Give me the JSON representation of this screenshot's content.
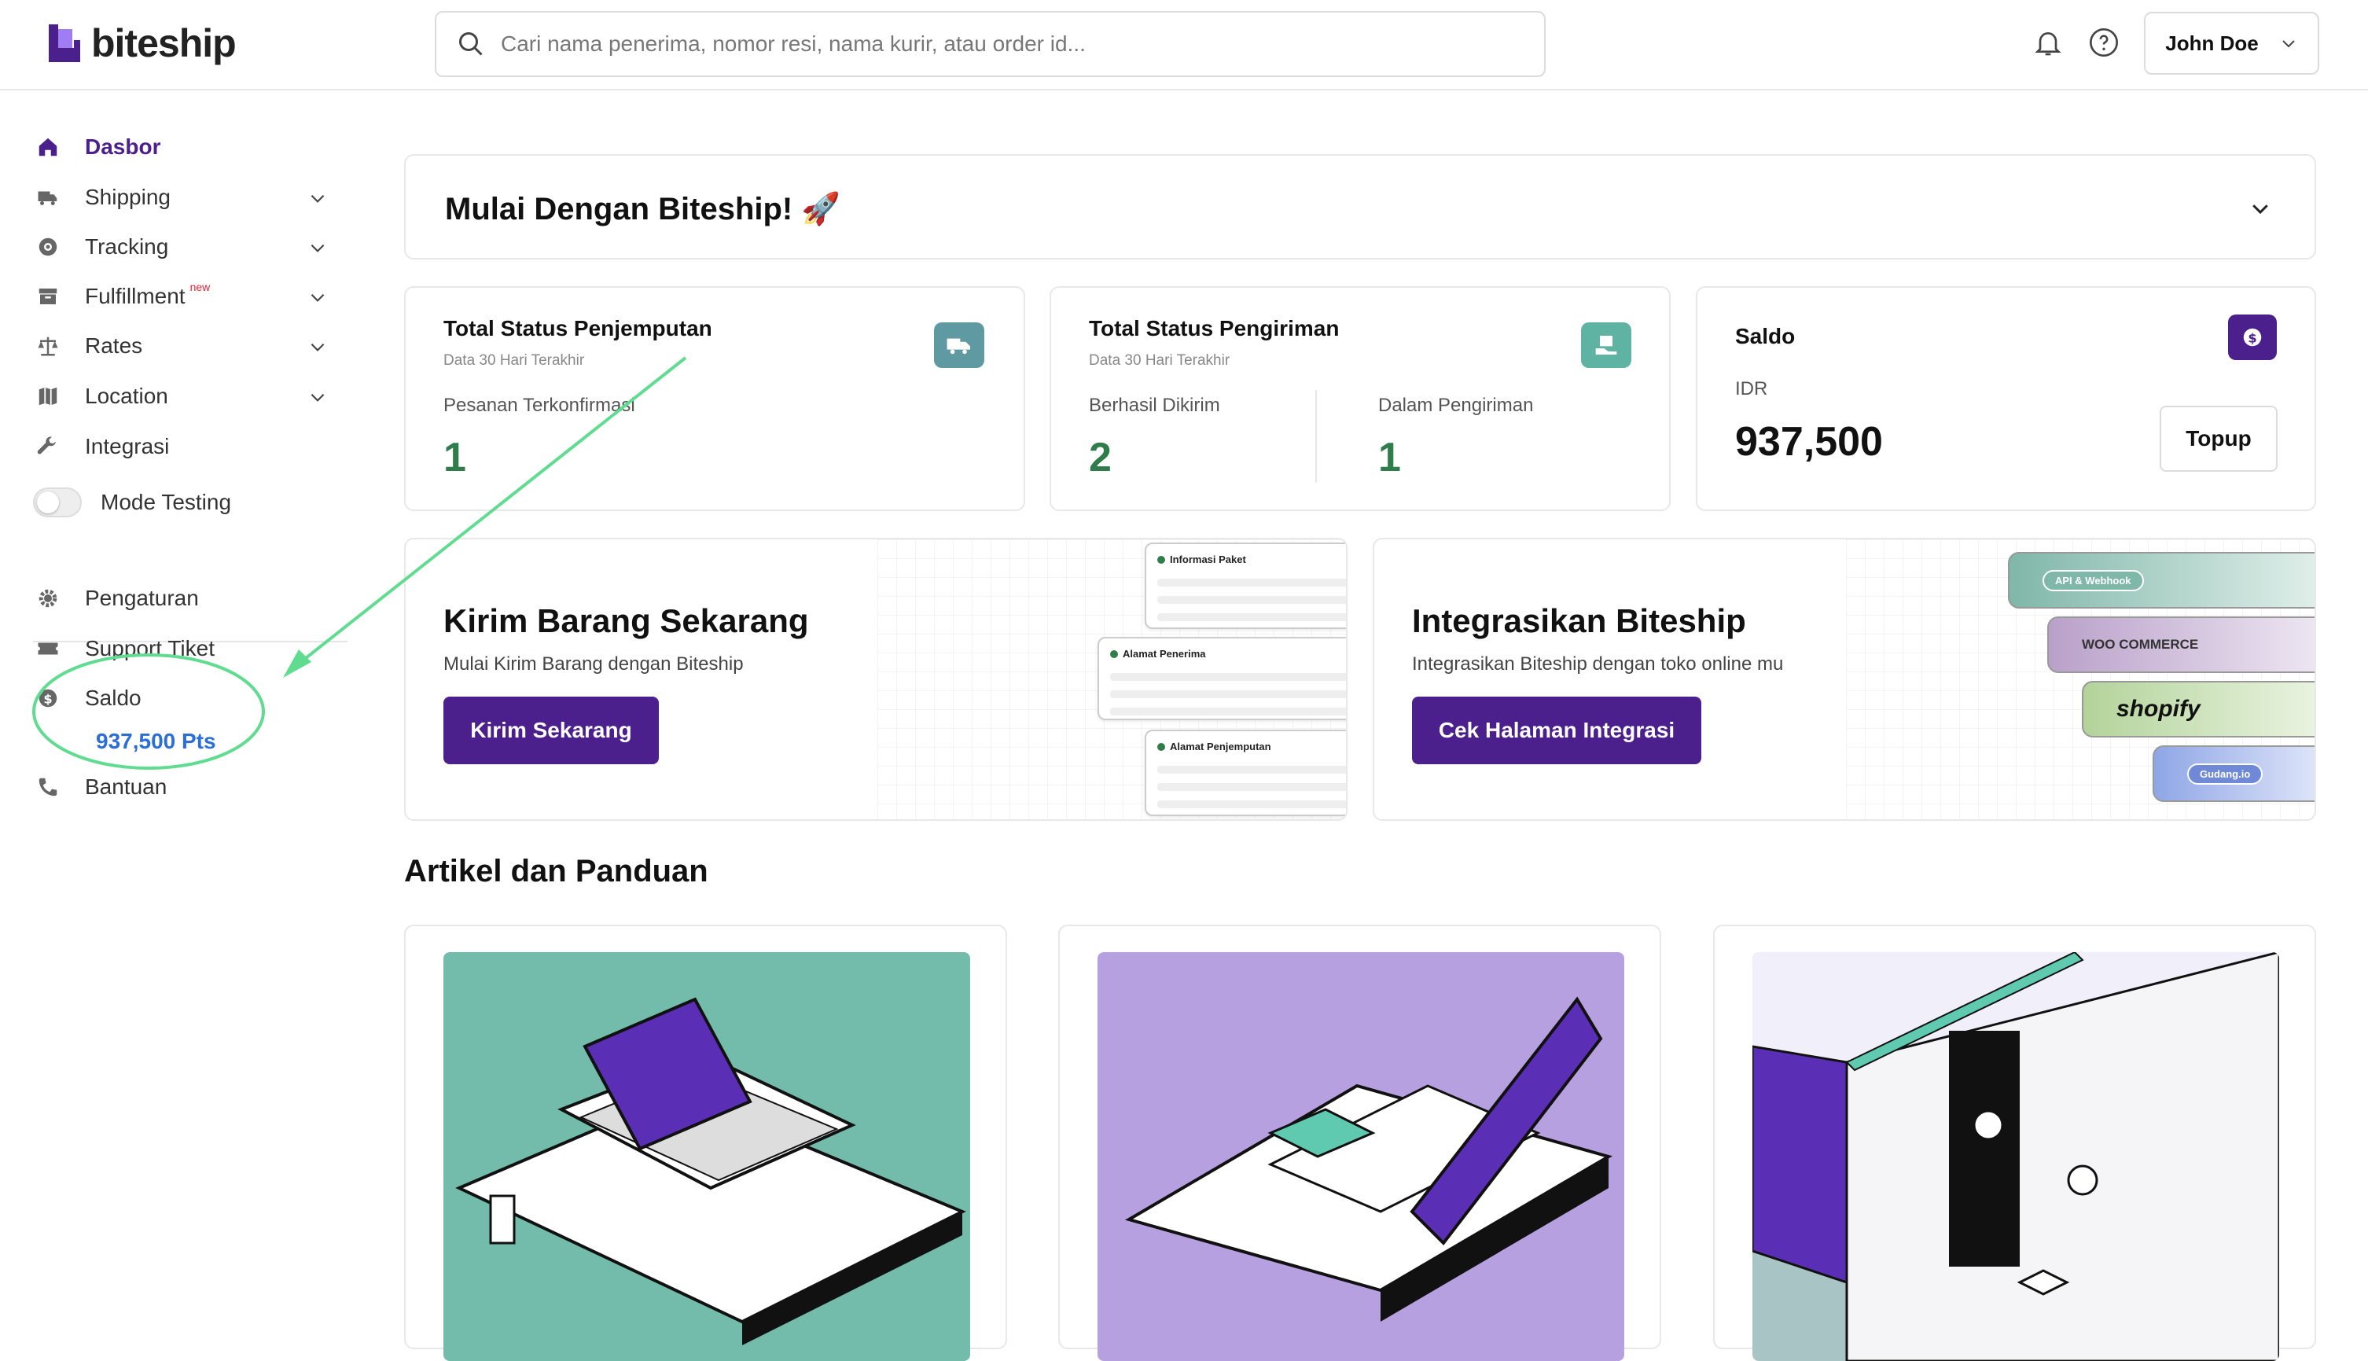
{
  "app": {
    "name": "biteship"
  },
  "search": {
    "placeholder": "Cari nama penerima, nomor resi, nama kurir, atau order id..."
  },
  "user": {
    "name": "John Doe"
  },
  "sidebar": {
    "items": [
      {
        "label": "Dasbor",
        "icon": "home-icon"
      },
      {
        "label": "Shipping",
        "icon": "truck-icon"
      },
      {
        "label": "Tracking",
        "icon": "tracking-icon"
      },
      {
        "label": "Fulfillment",
        "icon": "box-icon",
        "badge": "new"
      },
      {
        "label": "Rates",
        "icon": "scale-icon"
      },
      {
        "label": "Location",
        "icon": "map-icon"
      },
      {
        "label": "Integrasi",
        "icon": "wrench-icon"
      },
      {
        "label": "Mode Testing",
        "icon": "toggle-icon"
      },
      {
        "label": "Pengaturan",
        "icon": "gear-icon"
      },
      {
        "label": "Support Tiket",
        "icon": "ticket-icon"
      },
      {
        "label": "Saldo",
        "icon": "dollar-icon"
      },
      {
        "label": "Bantuan",
        "icon": "phone-icon"
      }
    ],
    "saldo_points": "937,500 Pts"
  },
  "welcome": {
    "title": "Mulai Dengan Biteship! 🚀"
  },
  "pickup_status": {
    "title": "Total Status Penjemputan",
    "subtitle": "Data 30 Hari Terakhir",
    "label": "Pesanan Terkonfirmasi",
    "value": "1"
  },
  "delivery_status": {
    "title": "Total Status Pengiriman",
    "subtitle": "Data 30 Hari Terakhir",
    "delivered_label": "Berhasil Dikirim",
    "delivered_value": "2",
    "in_transit_label": "Dalam Pengiriman",
    "in_transit_value": "1"
  },
  "balance": {
    "title": "Saldo",
    "currency": "IDR",
    "amount": "937,500",
    "topup_label": "Topup"
  },
  "send_banner": {
    "title": "Kirim Barang Sekarang",
    "subtitle": "Mulai Kirim Barang dengan Biteship",
    "button": "Kirim Sekarang",
    "cards": [
      "Informasi Paket",
      "Alamat Penerima",
      "Alamat Penjemputan"
    ]
  },
  "integration_banner": {
    "title": "Integrasikan Biteship",
    "subtitle": "Integrasikan Biteship dengan toko online mu",
    "button": "Cek Halaman Integrasi",
    "partners": [
      "API & Webhook",
      "WOO COMMERCE",
      "shopify",
      "Gudang.io"
    ]
  },
  "articles": {
    "title": "Artikel dan Panduan"
  },
  "colors": {
    "primary": "#4b1f8c",
    "success": "#2e7d4a",
    "annotation": "#5fdc8f",
    "points": "#2b6fd6"
  }
}
